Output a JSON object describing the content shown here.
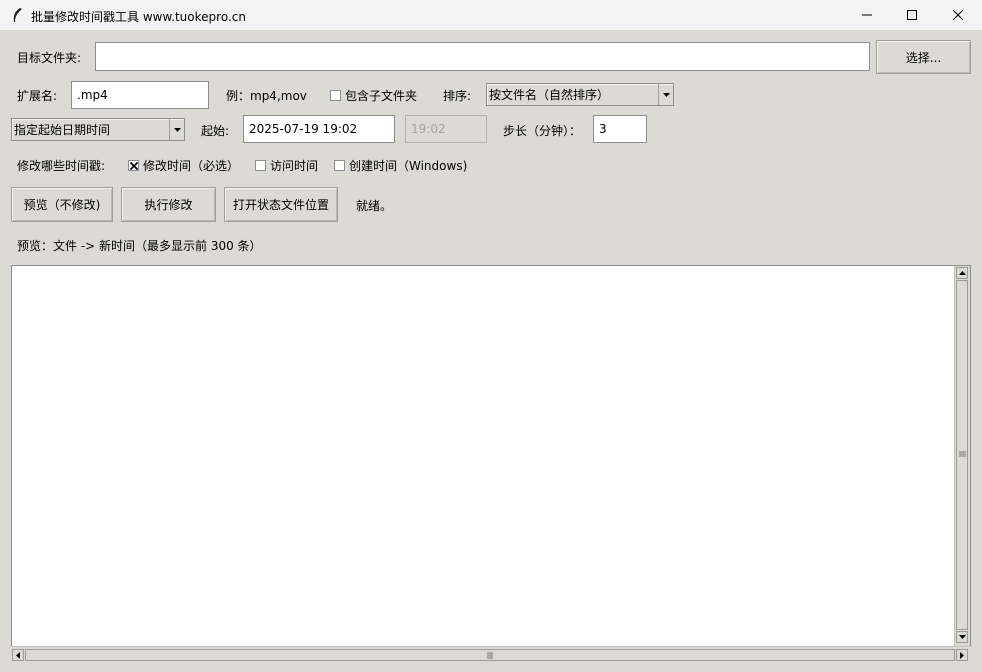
{
  "window": {
    "title": "批量修改时间戳工具  www.tuokepro.cn",
    "minimize": "minimize",
    "maximize": "maximize",
    "close": "close"
  },
  "folder": {
    "label": "目标文件夹:",
    "value": "",
    "browse_button": "选择..."
  },
  "extension": {
    "label": "扩展名:",
    "value": ".mp4",
    "example": "例：mp4,mov",
    "include_subfolders_label": "包含子文件夹",
    "include_subfolders_checked": false,
    "sort_label": "排序:",
    "sort_value": "按文件名（自然排序）"
  },
  "timing": {
    "mode_value": "指定起始日期时间",
    "start_label": "起始:",
    "start_value": "2025-07-19 19:02",
    "time_value": "19:02",
    "step_label": "步长（分钟）：",
    "step_value": "3"
  },
  "stamps": {
    "label": "修改哪些时间戳:",
    "modified_label": "修改时间（必选）",
    "modified_checked": true,
    "accessed_label": "访问时间",
    "accessed_checked": false,
    "created_label": "创建时间（Windows)",
    "created_checked": false
  },
  "actions": {
    "preview_button": "预览（不修改)",
    "execute_button": "执行修改",
    "open_state_button": "打开状态文件位置",
    "status": "就绪。"
  },
  "preview": {
    "heading": "预览：文件 -> 新时间（最多显示前 300 条）",
    "items": []
  },
  "icons": {
    "app": "feather-icon",
    "combo_arrow": "triangle-down-icon",
    "check": "x-check-icon"
  }
}
